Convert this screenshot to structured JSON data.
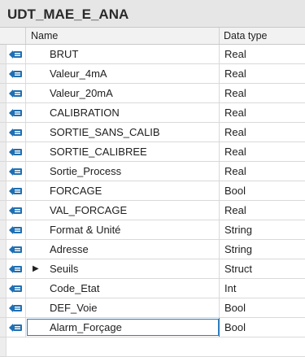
{
  "title": "UDT_MAE_E_ANA",
  "columns": {
    "name": "Name",
    "data_type": "Data type"
  },
  "rows": [
    {
      "name": "BRUT",
      "type": "Real"
    },
    {
      "name": "Valeur_4mA",
      "type": "Real"
    },
    {
      "name": "Valeur_20mA",
      "type": "Real"
    },
    {
      "name": "CALIBRATION",
      "type": "Real"
    },
    {
      "name": "SORTIE_SANS_CALIB",
      "type": "Real"
    },
    {
      "name": "SORTIE_CALIBREE",
      "type": "Real"
    },
    {
      "name": "Sortie_Process",
      "type": "Real"
    },
    {
      "name": "FORCAGE",
      "type": "Bool"
    },
    {
      "name": "VAL_FORCAGE",
      "type": "Real"
    },
    {
      "name": "Format & Unité",
      "type": "String"
    },
    {
      "name": "Adresse",
      "type": "String"
    },
    {
      "name": "Seuils",
      "type": "Struct",
      "expandable": true
    },
    {
      "name": "Code_Etat",
      "type": "Int"
    },
    {
      "name": "DEF_Voie",
      "type": "Bool"
    },
    {
      "name": "Alarm_Forçage",
      "type": "Bool",
      "selected": true
    }
  ],
  "icons": {
    "row_icon": "input-member-icon",
    "expander": "expand-arrow-icon"
  },
  "colors": {
    "icon_blue": "#1f6fb2",
    "selection_border": "#2c7dbd"
  }
}
